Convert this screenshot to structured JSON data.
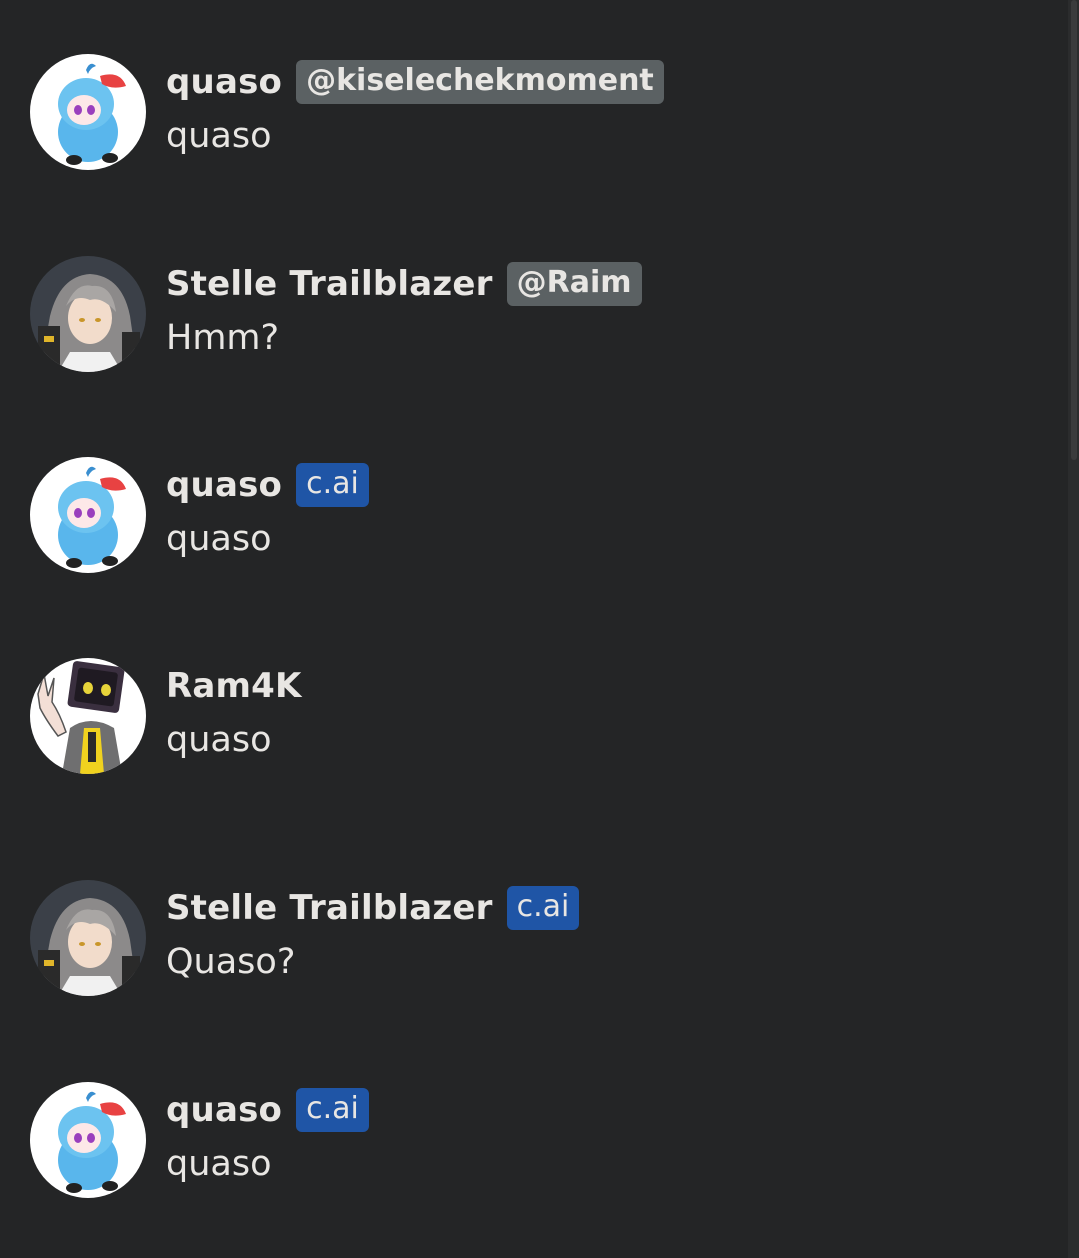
{
  "messages": [
    {
      "name": "quaso",
      "badge": "@kiselechekmoment",
      "badge_type": "handle",
      "text": "quaso",
      "avatar": "pig-mascot-avatar"
    },
    {
      "name": "Stelle Trailblazer",
      "badge": "@Raim",
      "badge_type": "handle",
      "text": "Hmm?",
      "avatar": "anime-girl-avatar"
    },
    {
      "name": "quaso",
      "badge": "c.ai",
      "badge_type": "cai",
      "text": "quaso",
      "avatar": "pig-mascot-avatar"
    },
    {
      "name": "Ram4K",
      "badge": "",
      "badge_type": "none",
      "text": "quaso",
      "avatar": "tv-head-avatar"
    },
    {
      "name": "Stelle Trailblazer",
      "badge": "c.ai",
      "badge_type": "cai",
      "text": "Quaso?",
      "avatar": "anime-girl-avatar"
    },
    {
      "name": "quaso",
      "badge": "c.ai",
      "badge_type": "cai",
      "text": "quaso",
      "avatar": "pig-mascot-avatar"
    }
  ],
  "colors": {
    "background": "#242526",
    "handle_badge": "#5b6163",
    "cai_badge": "#1f55a6",
    "text": "#e8e6e3"
  }
}
